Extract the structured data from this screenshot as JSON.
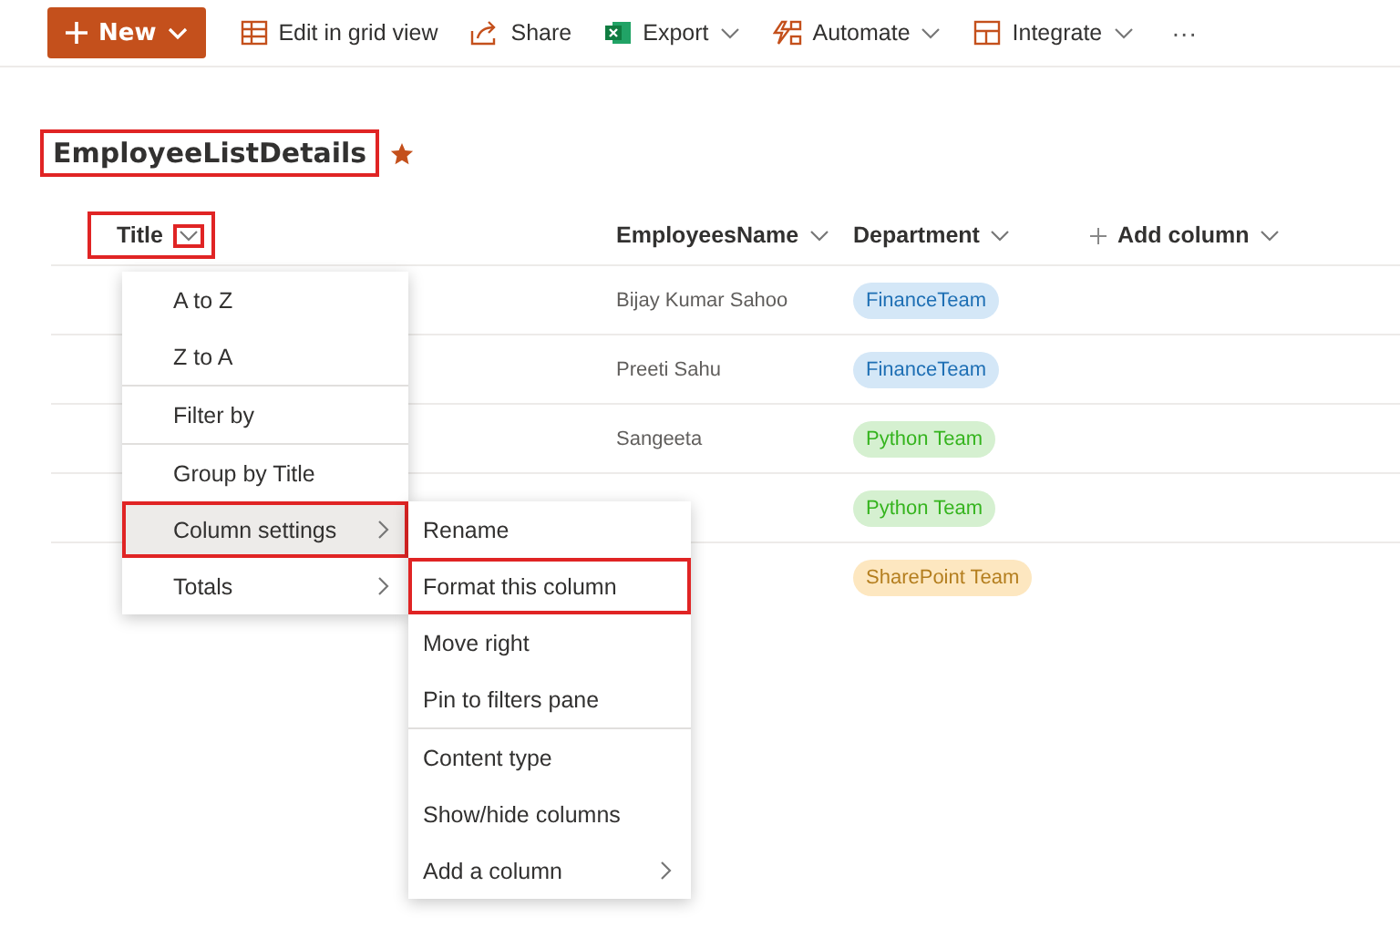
{
  "toolbar": {
    "new_button": {
      "label": "New"
    },
    "items": [
      {
        "kind": "grid",
        "label": "Edit in grid view",
        "dropdown": false
      },
      {
        "kind": "share",
        "label": "Share",
        "dropdown": false
      },
      {
        "kind": "excel",
        "label": "Export",
        "dropdown": true
      },
      {
        "kind": "automate",
        "label": "Automate",
        "dropdown": true
      },
      {
        "kind": "integrate",
        "label": "Integrate",
        "dropdown": true
      }
    ],
    "more": "···"
  },
  "list": {
    "title": "EmployeeListDetails",
    "title_highlighted": true,
    "favorite": true
  },
  "table": {
    "columns": [
      {
        "label": "Title",
        "highlighted": true
      },
      {
        "label": "EmployeesName",
        "highlighted": false
      },
      {
        "label": "Department",
        "highlighted": false
      },
      {
        "label": "Add column",
        "highlighted": false
      }
    ],
    "rows": [
      {
        "name": "Bijay Kumar Sahoo",
        "department": {
          "label": "FinanceTeam",
          "color": "#d4e7f7"
        }
      },
      {
        "name": "Preeti Sahu",
        "department": {
          "label": "FinanceTeam",
          "color": "#d4e7f7"
        }
      },
      {
        "name": "Sangeeta",
        "department": {
          "label": "Python Team",
          "color": "#d5f0d0"
        }
      },
      {
        "department": {
          "label": "Python Team",
          "color": "#d5f0d0"
        }
      },
      {
        "department": {
          "label": "SharePoint Team",
          "color": "#fde7c0"
        }
      }
    ]
  },
  "column_menu": {
    "groups": [
      [
        {
          "label": "A to Z",
          "selected": false,
          "submenu": false,
          "highlighted": false
        },
        {
          "label": "Z to A",
          "selected": false,
          "submenu": false,
          "highlighted": false
        }
      ],
      [
        {
          "label": "Filter by",
          "selected": false,
          "submenu": false,
          "highlighted": false
        }
      ],
      [
        {
          "label": "Group by Title",
          "selected": false,
          "submenu": false,
          "highlighted": false
        },
        {
          "label": "Column settings",
          "selected": true,
          "submenu": true,
          "highlighted": true
        },
        {
          "label": "Totals",
          "selected": false,
          "submenu": true,
          "highlighted": false
        }
      ]
    ]
  },
  "settings_menu": {
    "groups": [
      [
        {
          "label": "Rename",
          "selected": false,
          "submenu": false,
          "highlighted": false
        },
        {
          "label": "Format this column",
          "selected": false,
          "submenu": false,
          "highlighted": true
        },
        {
          "label": "Move right",
          "selected": false,
          "submenu": false,
          "highlighted": false
        },
        {
          "label": "Pin to filters pane",
          "selected": false,
          "submenu": false,
          "highlighted": false
        }
      ],
      [
        {
          "label": "Content type",
          "selected": false,
          "submenu": false,
          "highlighted": false
        },
        {
          "label": "Show/hide columns",
          "selected": false,
          "submenu": false,
          "highlighted": false
        },
        {
          "label": "Add a column",
          "selected": false,
          "submenu": true,
          "highlighted": false
        }
      ]
    ]
  }
}
